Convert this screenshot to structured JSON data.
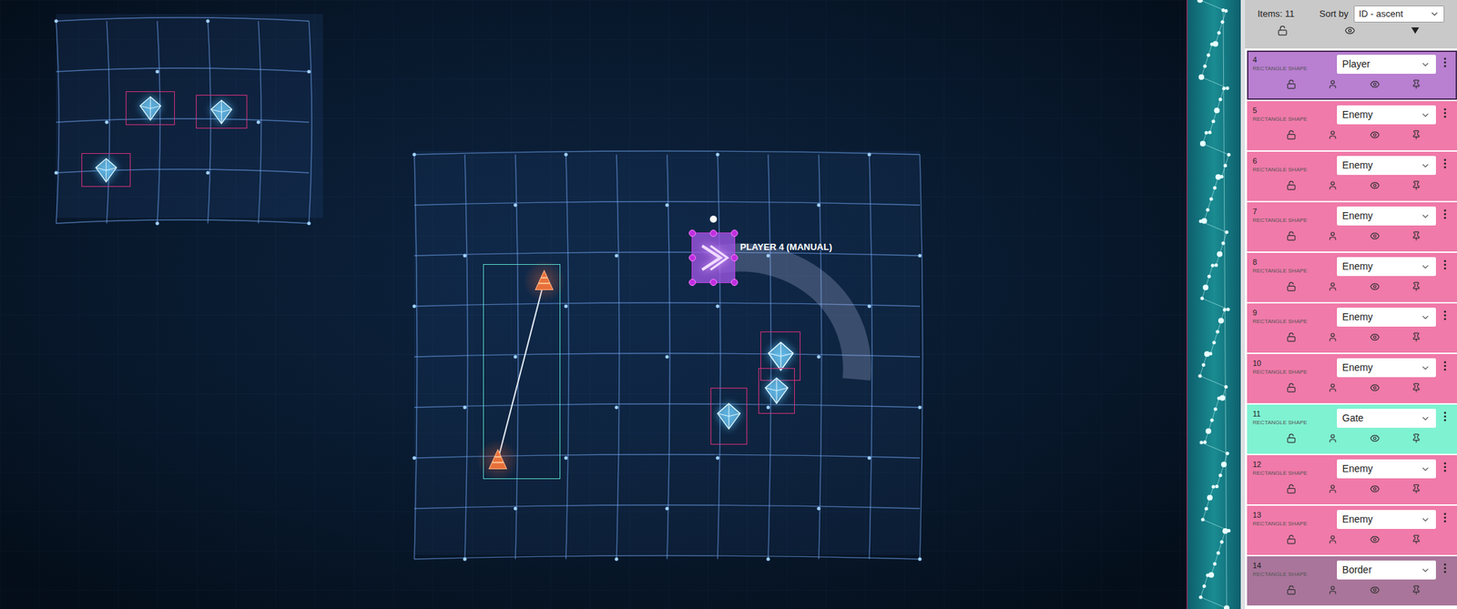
{
  "canvas": {
    "player_label": "PLAYER 4 (MANUAL)",
    "player_selected": true
  },
  "panel": {
    "count": "Items: 11",
    "sort_label": "Sort by",
    "sort_value": "ID - ascent"
  },
  "items": [
    {
      "id": "4",
      "type": "RECTANGLE SHAPE",
      "role": "Player",
      "selected": true,
      "color": "#b97fd1"
    },
    {
      "id": "5",
      "type": "RECTANGLE SHAPE",
      "role": "Enemy",
      "selected": false,
      "color": "#f07aa9"
    },
    {
      "id": "6",
      "type": "RECTANGLE SHAPE",
      "role": "Enemy",
      "selected": false,
      "color": "#f07aa9"
    },
    {
      "id": "7",
      "type": "RECTANGLE SHAPE",
      "role": "Enemy",
      "selected": false,
      "color": "#f07aa9"
    },
    {
      "id": "8",
      "type": "RECTANGLE SHAPE",
      "role": "Enemy",
      "selected": false,
      "color": "#f07aa9"
    },
    {
      "id": "9",
      "type": "RECTANGLE SHAPE",
      "role": "Enemy",
      "selected": false,
      "color": "#f07aa9"
    },
    {
      "id": "10",
      "type": "RECTANGLE SHAPE",
      "role": "Enemy",
      "selected": false,
      "color": "#f07aa9"
    },
    {
      "id": "11",
      "type": "RECTANGLE SHAPE",
      "role": "Gate",
      "selected": false,
      "color": "#7ff2d2"
    },
    {
      "id": "12",
      "type": "RECTANGLE SHAPE",
      "role": "Enemy",
      "selected": false,
      "color": "#f07aa9"
    },
    {
      "id": "13",
      "type": "RECTANGLE SHAPE",
      "role": "Enemy",
      "selected": false,
      "color": "#f07aa9"
    },
    {
      "id": "14",
      "type": "RECTANGLE SHAPE",
      "role": "Border",
      "selected": false,
      "color": "#a9759a"
    }
  ]
}
